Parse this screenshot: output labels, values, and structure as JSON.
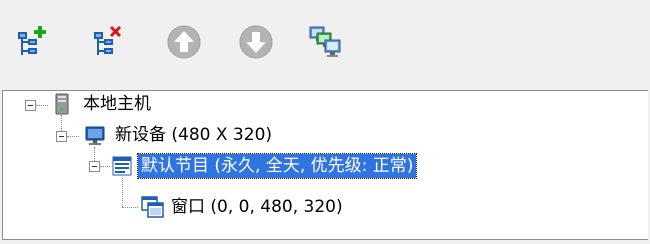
{
  "toolbar": {
    "buttons": [
      {
        "name": "add-node-button",
        "icon": "tree-add-icon"
      },
      {
        "name": "delete-node-button",
        "icon": "tree-delete-icon"
      },
      {
        "name": "move-up-button",
        "icon": "arrow-up-icon"
      },
      {
        "name": "move-down-button",
        "icon": "arrow-down-icon"
      },
      {
        "name": "network-button",
        "icon": "network-computers-icon"
      }
    ]
  },
  "tree": {
    "nodes": [
      {
        "label": "本地主机",
        "icon": "server-icon",
        "level": 0,
        "expanded": true
      },
      {
        "label": "新设备 (480 X 320)",
        "icon": "monitor-icon",
        "level": 1,
        "expanded": true
      },
      {
        "label": "默认节目 (永久, 全天, 优先级: 正常)",
        "icon": "program-icon",
        "level": 2,
        "expanded": true,
        "selected": true
      },
      {
        "label": "窗口 (0, 0, 480, 320)",
        "icon": "window-icon",
        "level": 3
      }
    ]
  },
  "colors": {
    "selection": "#2f74e0",
    "toolbar_bg": "#f0f0f0",
    "panel_bg": "#ffffff",
    "add_badge": "#1fa31f",
    "delete_badge": "#d81818",
    "tree_icon": "#1d5fb0",
    "disabled_circle": "#b4b4b4"
  }
}
